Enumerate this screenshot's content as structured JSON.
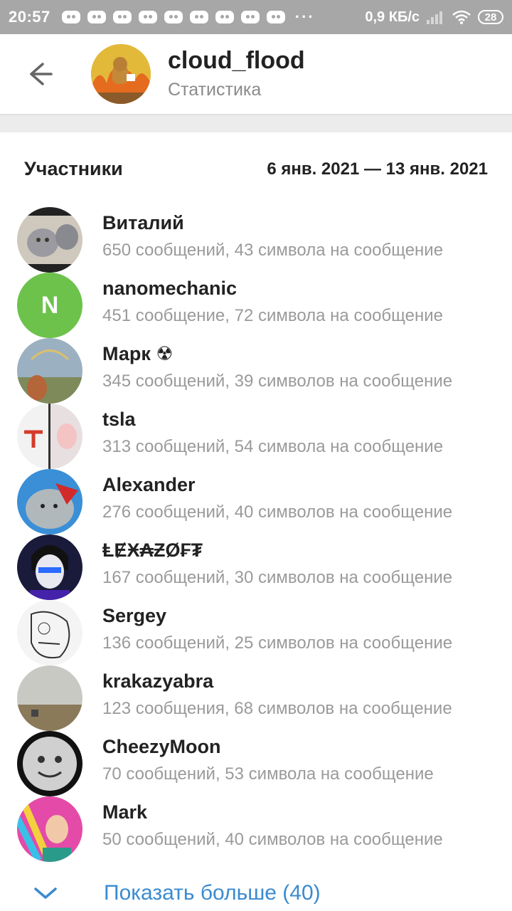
{
  "status_bar": {
    "time": "20:57",
    "more": "···",
    "speed": "0,9 КБ/с",
    "battery": "28",
    "notification_icons": [
      "discord-icon",
      "discord-icon",
      "discord-icon",
      "discord-icon",
      "discord-icon",
      "discord-icon",
      "discord-icon",
      "discord-icon",
      "discord-icon",
      "discord-icon"
    ]
  },
  "header": {
    "title": "cloud_flood",
    "subtitle": "Статистика",
    "back_icon": "back-arrow-icon"
  },
  "section": {
    "title": "Участники",
    "date_range": "6 янв. 2021 — 13 янв. 2021"
  },
  "members": [
    {
      "name": "Виталий",
      "stats": "650 сообщений, 43 символа на сообщение"
    },
    {
      "name": "nanomechanic",
      "stats": "451 сообщение, 72 символа на сообщение",
      "initial": "N"
    },
    {
      "name": "Марк ☢",
      "stats": "345 сообщений, 39 символов на сообщение"
    },
    {
      "name": "tsla",
      "stats": "313 сообщений, 54 символа на сообщение"
    },
    {
      "name": "Alexander",
      "stats": "276 сообщений, 40 символов на сообщение"
    },
    {
      "name": "ⱠɆӾ₳ƵØ₣₮",
      "stats": "167 сообщений, 30 символов на сообщение"
    },
    {
      "name": "Sergey",
      "stats": "136 сообщений, 25 символов на сообщение"
    },
    {
      "name": "krakazyabra",
      "stats": "123 сообщения, 68 символов на сообщение"
    },
    {
      "name": "CheezyMoon",
      "stats": "70 сообщений, 53 символа на сообщение"
    },
    {
      "name": "Mark",
      "stats": "50 сообщений, 40 символов на сообщение"
    }
  ],
  "show_more": {
    "label": "Показать больше (40)"
  },
  "colors": {
    "status_bar": "#a7a7a7",
    "accent": "#3a8bd0",
    "avatar_green": "#6cc24a",
    "secondary_text": "#9a9a9a"
  }
}
